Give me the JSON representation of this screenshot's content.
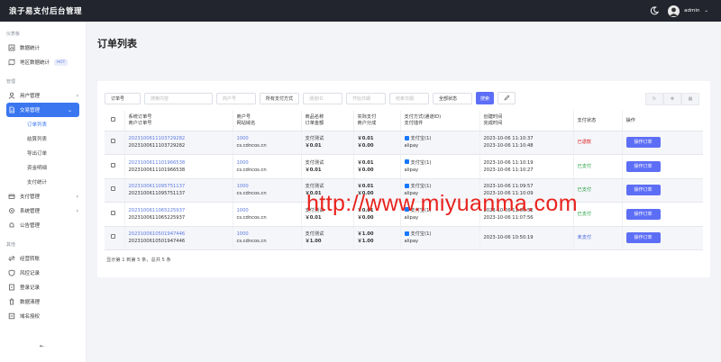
{
  "header": {
    "brand": "浪子易支付后台管理",
    "user": "admin",
    "user_caret": "⌄"
  },
  "sidebar": {
    "section_main": "仪表板",
    "stats": "数据统计",
    "region_stats": "地区数据统计",
    "hot_badge": "HOT",
    "section_manage": "管理",
    "user_mgmt": "用户管理",
    "trade_mgmt": "交易管理",
    "trade_sub": [
      "订单列表",
      "结算列表",
      "导出订单",
      "资金明细",
      "支付统计"
    ],
    "pay_mgmt": "支付管理",
    "sys_mgmt": "系统管理",
    "notice_mgmt": "公告管理",
    "section_other": "其他",
    "others": [
      "经营转账",
      "风控记录",
      "登录记录",
      "数据清理",
      "域名授权"
    ],
    "collapse": "⇤"
  },
  "page": {
    "title": "订单列表"
  },
  "filters": {
    "order_type": "订单号",
    "search_placeholder": "搜索内容",
    "merchant_placeholder": "商户号",
    "pay_method": "所有支付方式",
    "channel_placeholder": "通道ID",
    "start_placeholder": "开始日期",
    "end_placeholder": "结束日期",
    "status": "全部状态",
    "search_btn": "搜索"
  },
  "table": {
    "headers": [
      [
        "系统订单号",
        "商户订单号"
      ],
      [
        "商户号",
        "网站域名"
      ],
      [
        "商品名称",
        "订单金额"
      ],
      [
        "实际支付",
        "商户分成"
      ],
      [
        "支付方式(通道ID)",
        "支付插件"
      ],
      [
        "创建时间",
        "完成时间"
      ],
      [
        "支付状态"
      ],
      [
        "操作"
      ]
    ],
    "rows": [
      {
        "sys_no": "2023100611103729282",
        "mer_no": "2023100611103729282",
        "mid": "1000",
        "domain": "cs.cdncos.cn",
        "product": "支付测试",
        "amount": "￥0.01",
        "paid": "￥0.01",
        "share": "￥0.00",
        "method": "支付宝(1)",
        "plugin": "alipay",
        "created": "2023-10-06 11:10:37",
        "finished": "2023-10-06 11:10:48",
        "status": "已退款",
        "status_color": "#e02020",
        "op": "操作订单"
      },
      {
        "sys_no": "2023100611101966538",
        "mer_no": "2023100611101966538",
        "mid": "1000",
        "domain": "cs.cdncos.cn",
        "product": "支付测试",
        "amount": "￥0.01",
        "paid": "￥0.01",
        "share": "￥0.00",
        "method": "支付宝(1)",
        "plugin": "alipay",
        "created": "2023-10-06 11:10:19",
        "finished": "2023-10-06 11:10:27",
        "status": "已支付",
        "status_color": "#1f9d3c",
        "op": "操作订单"
      },
      {
        "sys_no": "2023100611095751137",
        "mer_no": "2023100611095751137",
        "mid": "1000",
        "domain": "cs.cdncos.cn",
        "product": "支付测试",
        "amount": "￥0.01",
        "paid": "￥0.01",
        "share": "￥0.00",
        "method": "支付宝(1)",
        "plugin": "alipay",
        "created": "2023-10-06 11:09:57",
        "finished": "2023-10-06 11:10:09",
        "status": "已支付",
        "status_color": "#1f9d3c",
        "op": "操作订单"
      },
      {
        "sys_no": "2023100611065225937",
        "mer_no": "2023100611065225937",
        "mid": "1000",
        "domain": "cs.cdncos.cn",
        "product": "支付测试",
        "amount": "￥0.01",
        "paid": "￥0.01",
        "share": "￥0.00",
        "method": "支付宝(1)",
        "plugin": "alipay",
        "created": "2023-10-06 11:06:52",
        "finished": "2023-10-06 11:07:56",
        "status": "已支付",
        "status_color": "#1f9d3c",
        "op": "操作订单"
      },
      {
        "sys_no": "2023100610501947446",
        "mer_no": "2023100610501947446",
        "mid": "1000",
        "domain": "cs.cdncos.cn",
        "product": "支付测试",
        "amount": "￥1.00",
        "paid": "￥1.00",
        "share": "￥1.00",
        "method": "支付宝(1)",
        "plugin": "alipay",
        "created": "2023-10-06 10:50:19",
        "finished": "",
        "status": "未支付",
        "status_color": "#3b5bdb",
        "op": "操作订单"
      }
    ]
  },
  "footer": {
    "summary": "显示第 1 到第 5 条，总共 5 条"
  },
  "watermark": "http://www.miyuanma.com"
}
